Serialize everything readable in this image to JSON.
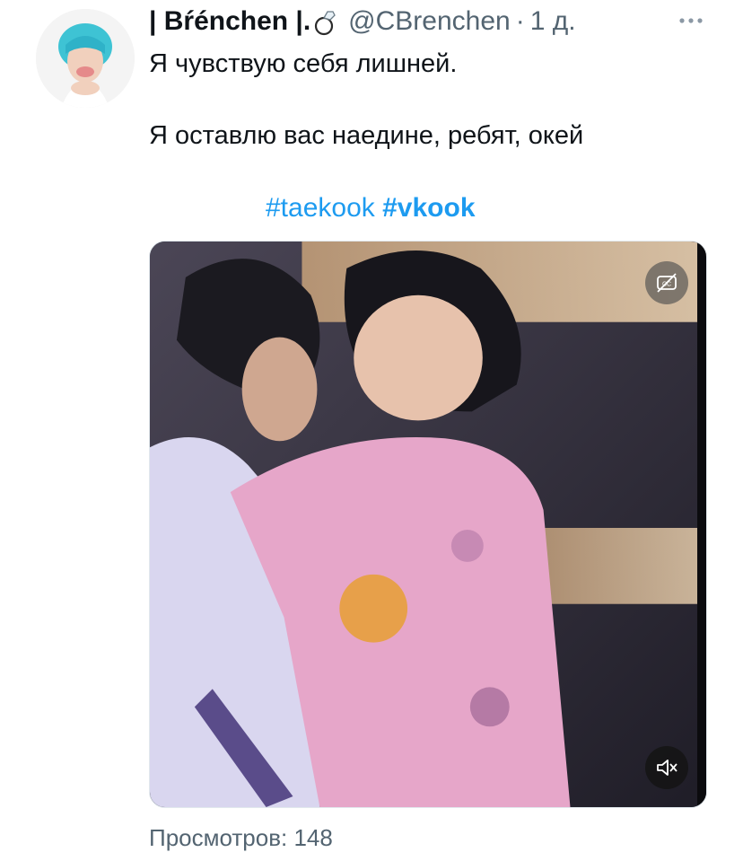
{
  "author": {
    "display_name": "| Bŕénchen |.",
    "handle": "@CBrenchen",
    "separator": "·",
    "time": "1 д."
  },
  "tweet": {
    "line1": "Я чувствую себя лишней.",
    "line2": "Я оставлю вас наедине, ребят, окей",
    "hashtags": [
      "#taekook",
      "#vkook"
    ]
  },
  "media": {
    "cc_icon": "closed-captions-off-icon",
    "mute_icon": "speaker-muted-icon"
  },
  "views": "Просмотров: 148",
  "colors": {
    "link": "#1d9bf0",
    "secondary": "#536471",
    "text": "#0f1419"
  }
}
